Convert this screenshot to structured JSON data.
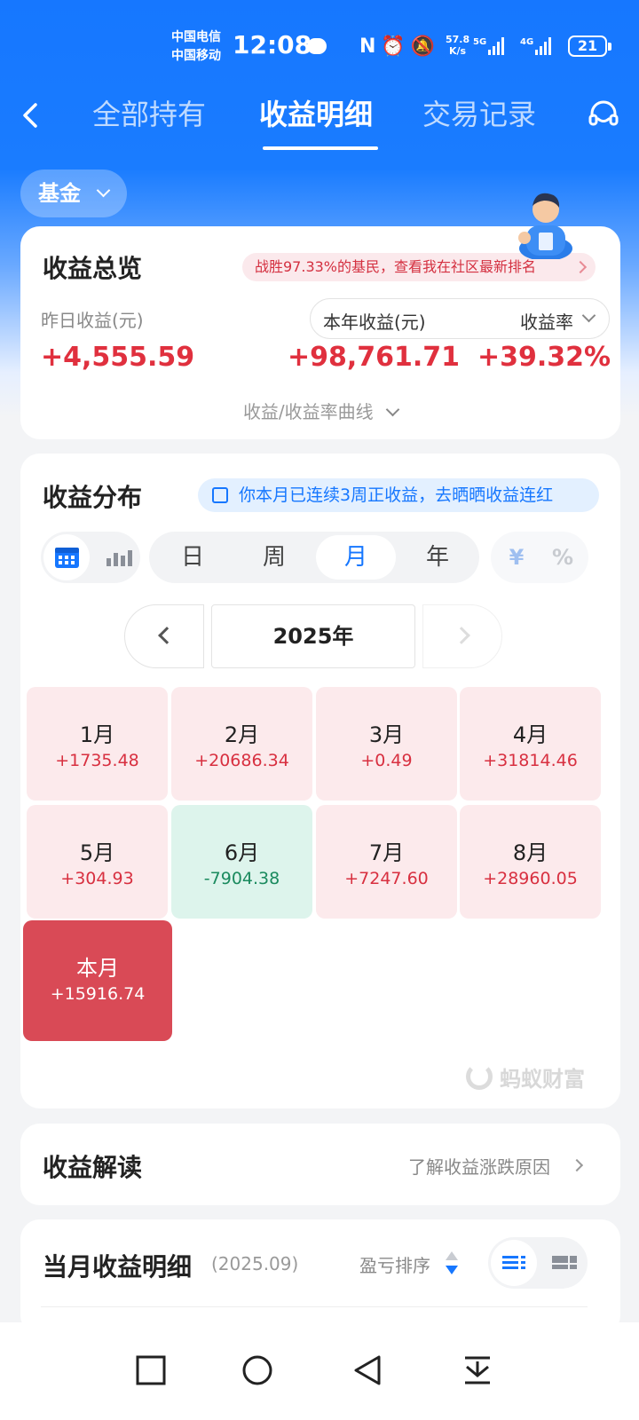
{
  "status_bar": {
    "carrier_1": "中国电信",
    "carrier_2": "中国移动",
    "time": "12:08",
    "icons": "N⏰🔕",
    "net_speed_value": "57.8",
    "net_speed_unit": "K/s",
    "signal_1": "5G",
    "signal_2": "4G",
    "battery": "21"
  },
  "nav": {
    "tabs": [
      {
        "label": "全部持有"
      },
      {
        "label": "收益明细"
      },
      {
        "label": "交易记录"
      }
    ],
    "active_tab": "收益明细"
  },
  "filter": {
    "asset_type": "基金"
  },
  "overview": {
    "title": "收益总览",
    "rank_banner": "战胜97.33%的基民，查看我在社区最新排名",
    "yesterday_label": "昨日收益(元)",
    "yesterday_value": "+4,555.59",
    "year_label": "本年收益(元)",
    "year_value": "+98,761.71",
    "rate_label": "收益率",
    "rate_value": "+39.32%",
    "curve_link": "收益/收益率曲线"
  },
  "distribution": {
    "title": "收益分布",
    "streak_banner": "你本月已连续3周正收益，去晒晒收益连红",
    "periods": [
      "日",
      "周",
      "月",
      "年"
    ],
    "active_period": "月",
    "units": [
      "¥",
      "%"
    ],
    "year": "2025年",
    "months": [
      {
        "name": "1月",
        "value": "+1735.48",
        "trend": "pos"
      },
      {
        "name": "2月",
        "value": "+20686.34",
        "trend": "pos"
      },
      {
        "name": "3月",
        "value": "+0.49",
        "trend": "pos"
      },
      {
        "name": "4月",
        "value": "+31814.46",
        "trend": "pos"
      },
      {
        "name": "5月",
        "value": "+304.93",
        "trend": "pos"
      },
      {
        "name": "6月",
        "value": "-7904.38",
        "trend": "neg"
      },
      {
        "name": "7月",
        "value": "+7247.60",
        "trend": "pos"
      },
      {
        "name": "8月",
        "value": "+28960.05",
        "trend": "pos"
      },
      {
        "name": "本月",
        "value": "+15916.74",
        "trend": "cur"
      }
    ],
    "watermark": "蚂蚁财富"
  },
  "interpretation": {
    "title": "收益解读",
    "link": "了解收益涨跌原因"
  },
  "monthly_detail": {
    "title": "当月收益明细",
    "period": "(2025.09)",
    "sort_label": "盈亏排序"
  },
  "colors": {
    "brand_blue": "#1677ff",
    "gain_red": "#e0303e",
    "loss_green": "#1a8a5e",
    "current_month_bg": "#d94a56"
  }
}
